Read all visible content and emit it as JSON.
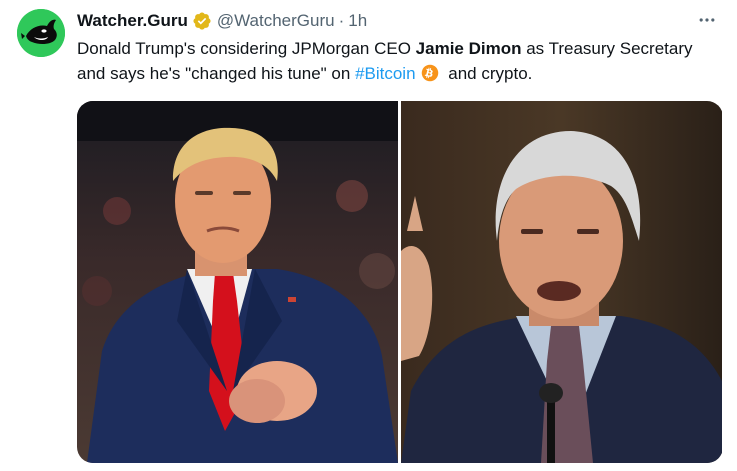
{
  "tweet": {
    "avatar_icon": "orca-logo-icon",
    "display_name": "Watcher.Guru",
    "verified_icon": "gold-verified-badge-icon",
    "handle": "@WatcherGuru",
    "separator": "·",
    "time": "1h",
    "more_icon": "more-horizontal-icon",
    "text": {
      "part1": "Donald Trump's considering JPMorgan CEO ",
      "bold_name": "Jamie Dimon",
      "part2": " as Treasury Secretary and says he's \"changed his tune\" on ",
      "hashtag": "#Bitcoin",
      "btc_icon": "bitcoin-icon",
      "part3": " and crypto."
    },
    "media": [
      {
        "name": "photo-trump",
        "description_icon": "photo"
      },
      {
        "name": "photo-dimon",
        "description_icon": "photo"
      }
    ]
  },
  "colors": {
    "avatar_bg": "#2fc85a",
    "verified": "#e2b719",
    "hashtag": "#1d9bf0",
    "bitcoin": "#f7931a",
    "secondary_text": "#536471"
  }
}
